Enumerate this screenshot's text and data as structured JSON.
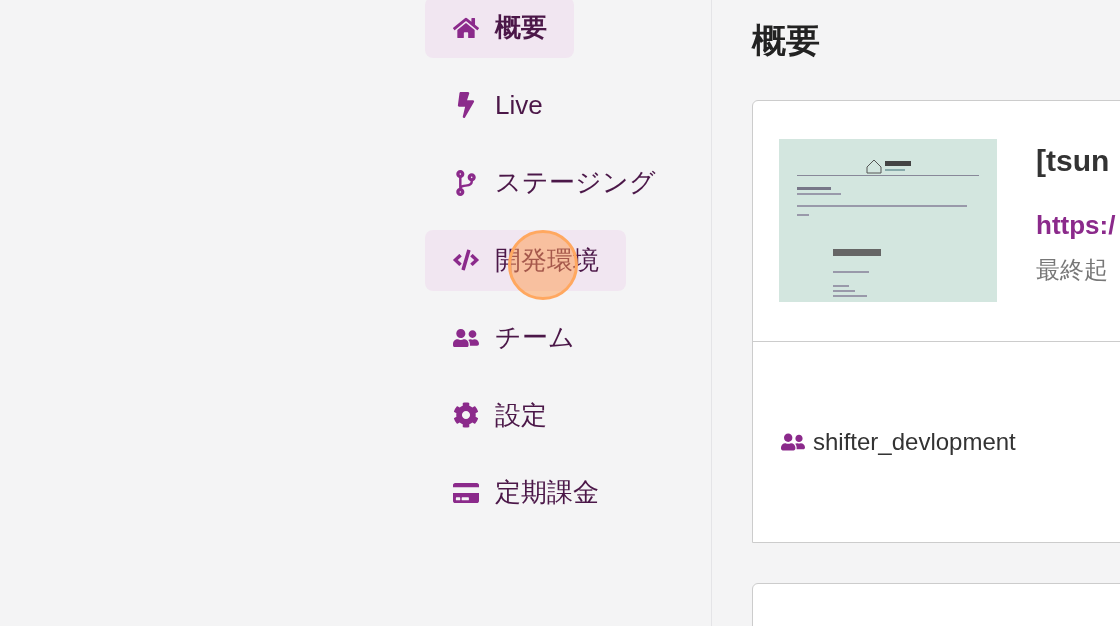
{
  "sidebar": {
    "items": [
      {
        "label": "概要",
        "selected": true,
        "hovered": false,
        "clicked": false
      },
      {
        "label": "Live",
        "selected": false,
        "hovered": false,
        "clicked": false
      },
      {
        "label": "ステージング",
        "selected": false,
        "hovered": false,
        "clicked": false
      },
      {
        "label": "開発環境",
        "selected": false,
        "hovered": true,
        "clicked": true
      },
      {
        "label": "チーム",
        "selected": false,
        "hovered": false,
        "clicked": false
      },
      {
        "label": "設定",
        "selected": false,
        "hovered": false,
        "clicked": false
      },
      {
        "label": "定期課金",
        "selected": false,
        "hovered": false,
        "clicked": false
      }
    ]
  },
  "main": {
    "title": "概要",
    "site_card": {
      "name": "[tsun",
      "url": "https:/",
      "last_started": "最終起"
    },
    "team_card": {
      "team": "shifter_devlopment"
    }
  }
}
